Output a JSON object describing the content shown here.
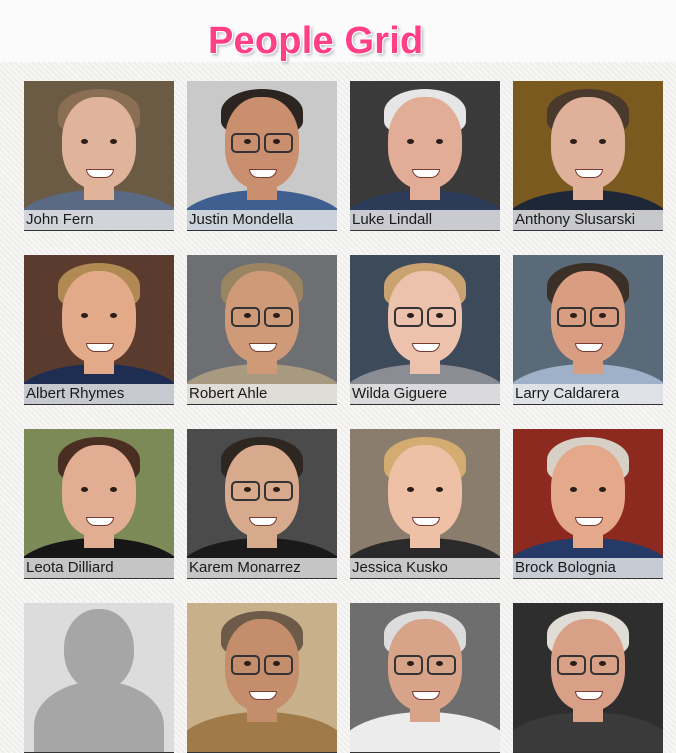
{
  "page": {
    "title": "People Grid"
  },
  "people": [
    {
      "name": "John Fern",
      "bg": "#6b5a44",
      "skin": "#e0b49a",
      "hair": "#8a6f55",
      "shirt": "#5a6a84",
      "glasses": false
    },
    {
      "name": "Justin Mondella",
      "bg": "#c9c9c9",
      "skin": "#c98f6e",
      "hair": "#2b2420",
      "shirt": "#3e5f8f",
      "glasses": true
    },
    {
      "name": "Luke Lindall",
      "bg": "#3a3a3a",
      "skin": "#e1ad97",
      "hair": "#e6e6e6",
      "shirt": "#2c3b58",
      "glasses": false
    },
    {
      "name": "Anthony Slusarski",
      "bg": "#7a5a1e",
      "skin": "#e0b19a",
      "hair": "#4a3a2e",
      "shirt": "#1d2738",
      "glasses": false
    },
    {
      "name": "Albert Rhymes",
      "bg": "#5a3b2e",
      "skin": "#e3aa8a",
      "hair": "#b08a52",
      "shirt": "#1e2e52",
      "glasses": false
    },
    {
      "name": "Robert Ahle",
      "bg": "#6d6f73",
      "skin": "#cf9a78",
      "hair": "#9a8462",
      "shirt": "#a89a80",
      "glasses": true
    },
    {
      "name": "Wilda Giguere",
      "bg": "#3d4a5a",
      "skin": "#edc2ad",
      "hair": "#c9a270",
      "shirt": "#8a8d94",
      "glasses": true
    },
    {
      "name": "Larry Caldarera",
      "bg": "#5b6a78",
      "skin": "#d99d82",
      "hair": "#3b3028",
      "shirt": "#9fb1c8",
      "glasses": true
    },
    {
      "name": "Leota Dilliard",
      "bg": "#7c8a58",
      "skin": "#e1ad93",
      "hair": "#4a2e22",
      "shirt": "#161616",
      "glasses": false
    },
    {
      "name": "Karem Monarrez",
      "bg": "#4b4b4b",
      "skin": "#d7a98d",
      "hair": "#2e2620",
      "shirt": "#1a1a1a",
      "glasses": true
    },
    {
      "name": "Jessica Kusko",
      "bg": "#8a7d6e",
      "skin": "#eec0a6",
      "hair": "#d4ac72",
      "shirt": "#2a2a2a",
      "glasses": false
    },
    {
      "name": "Brock Bolognia",
      "bg": "#8c2a20",
      "skin": "#e4a88a",
      "hair": "#d6d0c6",
      "shirt": "#253a66",
      "glasses": false
    },
    {
      "name": "",
      "placeholder": true
    },
    {
      "name": "",
      "bg": "#c8b08a",
      "skin": "#c48d6c",
      "hair": "#6d5a48",
      "shirt": "#a07a48",
      "glasses": true
    },
    {
      "name": "",
      "bg": "#6e6e6e",
      "skin": "#d7a48a",
      "hair": "#dcdcdc",
      "shirt": "#ececec",
      "glasses": true
    },
    {
      "name": "",
      "bg": "#2e2e2e",
      "skin": "#d9a088",
      "hair": "#e0dcd6",
      "shirt": "#3a3a3a",
      "glasses": true
    }
  ]
}
